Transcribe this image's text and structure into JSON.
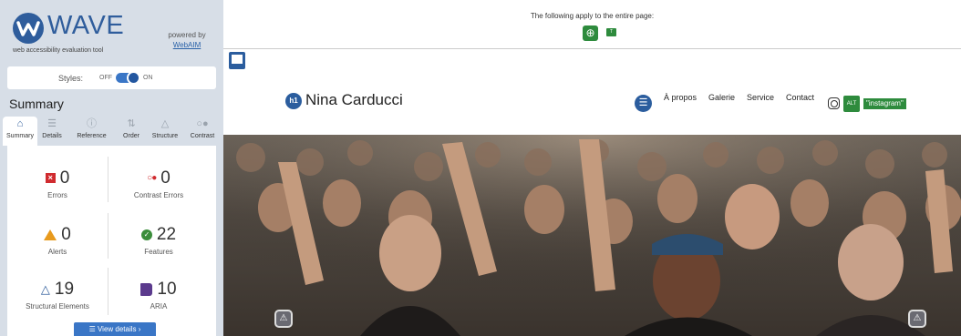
{
  "wave": {
    "logo_text": "WAVE",
    "subtitle": "web accessibility evaluation tool",
    "powered_by": "powered by",
    "webaim_link": "WebAIM",
    "styles_label": "Styles:",
    "styles_off": "OFF",
    "styles_on": "ON",
    "summary_heading": "Summary",
    "tabs": [
      {
        "label": "Summary",
        "icon": "home-icon",
        "active": true
      },
      {
        "label": "Details",
        "icon": "list-icon"
      },
      {
        "label": "Reference",
        "icon": "info-icon"
      },
      {
        "label": "Order",
        "icon": "order-icon"
      },
      {
        "label": "Structure",
        "icon": "structure-icon"
      },
      {
        "label": "Contrast",
        "icon": "contrast-icon"
      }
    ],
    "stats": {
      "errors": {
        "value": "0",
        "label": "Errors"
      },
      "contrast_errors": {
        "value": "0",
        "label": "Contrast Errors"
      },
      "alerts": {
        "value": "0",
        "label": "Alerts"
      },
      "features": {
        "value": "22",
        "label": "Features"
      },
      "structural": {
        "value": "19",
        "label": "Structural Elements"
      },
      "aria": {
        "value": "10",
        "label": "ARIA"
      }
    },
    "view_details": "View details ›"
  },
  "page_notice": "The following apply to the entire page:",
  "site": {
    "title": "Nina Carducci",
    "h1_badge": "h1",
    "nav": [
      "À propos",
      "Galerie",
      "Service",
      "Contact"
    ],
    "instagram_alt": "\"instagram\""
  },
  "colors": {
    "wave_blue": "#2f5d9c",
    "error_red": "#d02b2f",
    "alert_orange": "#e89a1d",
    "feature_green": "#2e8b3d",
    "aria_purple": "#5b3a8d",
    "panel_bg": "#d7dee7"
  }
}
